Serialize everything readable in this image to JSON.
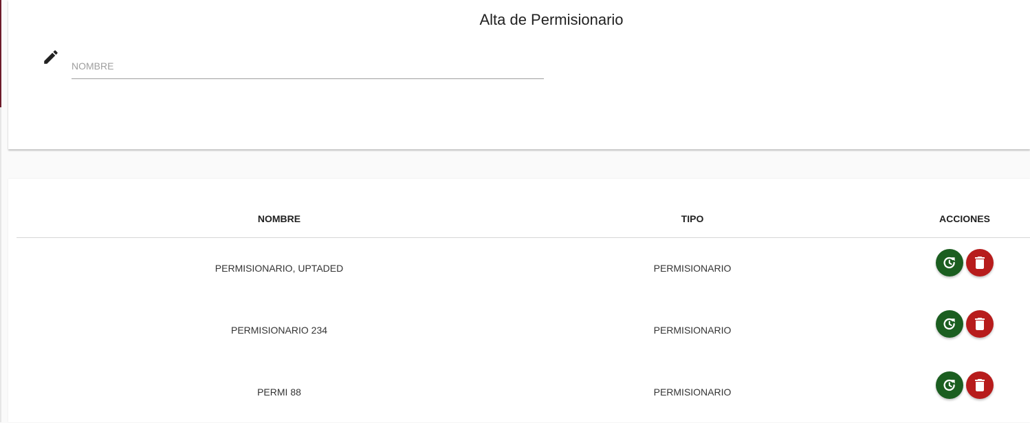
{
  "form": {
    "title": "Alta de Permisionario",
    "name_placeholder": "NOMBRE",
    "name_value": ""
  },
  "table": {
    "columns": [
      "NOMBRE",
      "TIPO",
      "ACCIONES"
    ],
    "rows": [
      {
        "nombre": "PERMISIONARIO, UPTADED",
        "tipo": "PERMISIONARIO"
      },
      {
        "nombre": "PERMISIONARIO 234",
        "tipo": "PERMISIONARIO"
      },
      {
        "nombre": "PERMI 88",
        "tipo": "PERMISIONARIO"
      }
    ]
  },
  "icons": {
    "field": "pencil-icon",
    "restore": "restore-icon",
    "delete": "trash-icon"
  },
  "colors": {
    "restore_button": "#1b5e20",
    "delete_button": "#b71c1c",
    "accent_strip": "#6d1b2b"
  }
}
